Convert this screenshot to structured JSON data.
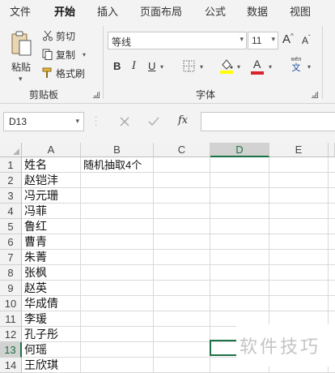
{
  "menu": {
    "tabs": [
      "文件",
      "开始",
      "插入",
      "页面布局",
      "公式",
      "数据",
      "视图"
    ]
  },
  "ribbon": {
    "clipboard": {
      "paste_label": "粘贴",
      "cut_label": "剪切",
      "copy_label": "复制",
      "format_painter_label": "格式刷",
      "group_label": "剪贴板"
    },
    "font": {
      "font_name": "等线",
      "font_size": "11",
      "grow_label": "A",
      "shrink_label": "A",
      "bold": "B",
      "italic": "I",
      "underline": "U",
      "font_color_label": "A",
      "phonetic_label": "wén",
      "phonetic_char": "文",
      "group_label": "字体",
      "accent_fill": "#ffff00",
      "accent_font": "#d9232e"
    }
  },
  "formula_bar": {
    "name_box": "D13",
    "fx_label": "fx",
    "formula": ""
  },
  "sheet": {
    "columns": [
      "A",
      "B",
      "C",
      "D",
      "E"
    ],
    "selected_column": "D",
    "rows": [
      "1",
      "2",
      "3",
      "4",
      "5",
      "6",
      "7",
      "8",
      "9",
      "10",
      "11",
      "12",
      "13",
      "14"
    ],
    "selected_row": "13",
    "col_a": [
      "姓名",
      "赵铠沣",
      "冯元珊",
      "冯菲",
      "鲁红",
      "曹青",
      "朱菁",
      "张枫",
      "赵英",
      "华成倩",
      "李瑗",
      "孔子彤",
      "何瑶",
      "王欣琪"
    ],
    "b1": "随机抽取4个"
  },
  "watermark": "软件技巧"
}
